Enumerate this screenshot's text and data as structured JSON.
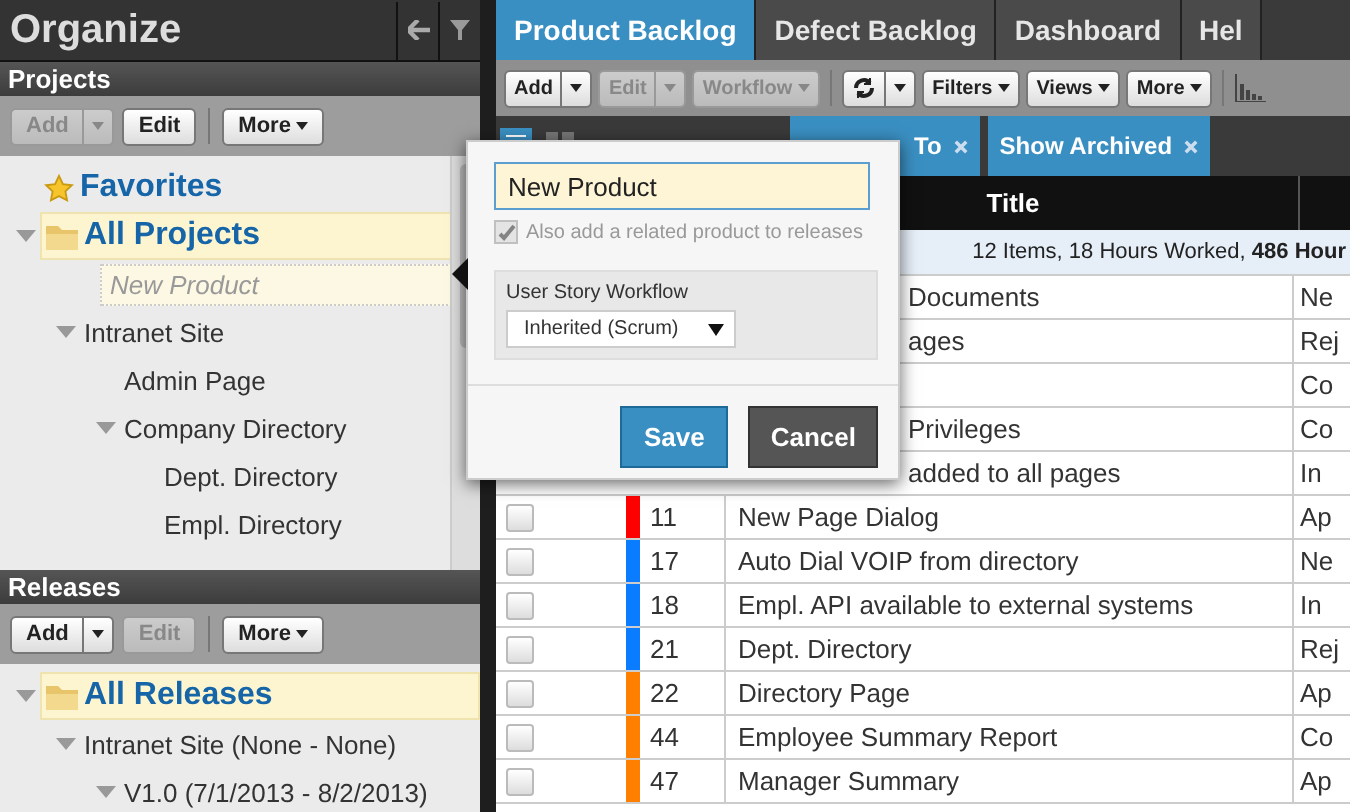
{
  "sidebar": {
    "title": "Organize",
    "projects": {
      "title": "Projects",
      "toolbar": [
        {
          "label": "Add",
          "kind": "split",
          "disabled": true
        },
        {
          "label": "Edit",
          "kind": "button",
          "disabled": false
        },
        {
          "label": "More",
          "kind": "menu",
          "disabled": false
        }
      ],
      "tree": [
        {
          "label": "Favorites",
          "kind": "favorites",
          "selected": false
        },
        {
          "label": "All Projects",
          "kind": "folder",
          "selected": true,
          "expanded": true,
          "children": [
            {
              "label": "New Product",
              "kind": "editing",
              "selected": false
            },
            {
              "label": "Intranet Site",
              "kind": "node",
              "selected": false,
              "expanded": true,
              "children": [
                {
                  "label": "Admin Page",
                  "kind": "node",
                  "selected": false
                },
                {
                  "label": "Company Directory",
                  "kind": "node",
                  "selected": false,
                  "expanded": true,
                  "children": [
                    {
                      "label": "Dept. Directory",
                      "kind": "node",
                      "selected": false
                    },
                    {
                      "label": "Empl. Directory",
                      "kind": "node",
                      "selected": false
                    }
                  ]
                }
              ]
            }
          ]
        }
      ]
    },
    "releases": {
      "title": "Releases",
      "toolbar": [
        {
          "label": "Add",
          "kind": "split",
          "disabled": false
        },
        {
          "label": "Edit",
          "kind": "button",
          "disabled": true
        },
        {
          "label": "More",
          "kind": "menu",
          "disabled": false
        }
      ],
      "tree": [
        {
          "label": "All Releases",
          "kind": "folder",
          "selected": true,
          "expanded": true,
          "children": [
            {
              "label": "Intranet Site (None - None)",
              "kind": "node",
              "selected": false,
              "expanded": true,
              "children": [
                {
                  "label": "V1.0 (7/1/2013 - 8/2/2013)",
                  "kind": "node",
                  "selected": false,
                  "expanded": true
                }
              ]
            }
          ]
        }
      ]
    }
  },
  "tabs": [
    {
      "label": "Product Backlog",
      "selected": true
    },
    {
      "label": "Defect Backlog",
      "selected": false
    },
    {
      "label": "Dashboard",
      "selected": false
    },
    {
      "label": "Hel",
      "selected": false
    }
  ],
  "toolbar": [
    {
      "label": "Add",
      "kind": "split",
      "disabled": false
    },
    {
      "label": "Edit",
      "kind": "split",
      "disabled": true
    },
    {
      "label": "Workflow",
      "kind": "menu",
      "disabled": true
    },
    {
      "kind": "refresh",
      "disabled": false
    },
    {
      "label": "Filters",
      "kind": "menu",
      "disabled": false
    },
    {
      "label": "Views",
      "kind": "menu",
      "disabled": false
    },
    {
      "label": "More",
      "kind": "menu",
      "disabled": false
    },
    {
      "kind": "chart"
    }
  ],
  "filters": [
    {
      "label": "To"
    },
    {
      "label": "Show Archived"
    }
  ],
  "table": {
    "columns": [
      "Title"
    ],
    "summary": "12 Items, 18 Hours Worked, **486 Hour**",
    "rows": [
      {
        "kind": "covered",
        "title": "Documents",
        "status": "Ne"
      },
      {
        "kind": "covered",
        "title": "ages",
        "status": "Rej"
      },
      {
        "kind": "covered",
        "status": "Co"
      },
      {
        "kind": "covered",
        "title": "Privileges",
        "status": "Co"
      },
      {
        "kind": "covered",
        "title": "added to all pages",
        "status": "In"
      },
      {
        "kind": "item",
        "checked": false,
        "color": "#ff0000",
        "id": "11",
        "title": "New Page Dialog",
        "status": "Ap"
      },
      {
        "kind": "item",
        "checked": false,
        "color": "#0a7cff",
        "id": "17",
        "title": "Auto Dial VOIP from directory",
        "status": "Ne"
      },
      {
        "kind": "item",
        "checked": false,
        "color": "#0a7cff",
        "id": "18",
        "title": "Empl. API available to external systems",
        "status": "In"
      },
      {
        "kind": "item",
        "checked": false,
        "color": "#0a7cff",
        "id": "21",
        "title": "Dept. Directory",
        "status": "Rej"
      },
      {
        "kind": "item",
        "checked": false,
        "color": "#ff7f00",
        "id": "22",
        "title": "Directory Page",
        "status": "Ap"
      },
      {
        "kind": "item",
        "checked": false,
        "color": "#ff7f00",
        "id": "44",
        "title": "Employee Summary Report",
        "status": "Co"
      },
      {
        "kind": "item",
        "checked": false,
        "color": "#ff7f00",
        "id": "47",
        "title": "Manager Summary",
        "status": "Ap"
      }
    ]
  },
  "popup": {
    "name_field": {
      "value": "New Product"
    },
    "related_checkbox": {
      "label": "Also add a related product to releases",
      "checked": true,
      "disabled": true
    },
    "workflow": {
      "label": "User Story Workflow",
      "value": "Inherited (Scrum)"
    },
    "buttons": [
      {
        "label": "Save",
        "kind": "primary"
      },
      {
        "label": "Cancel",
        "kind": "secondary"
      }
    ]
  }
}
